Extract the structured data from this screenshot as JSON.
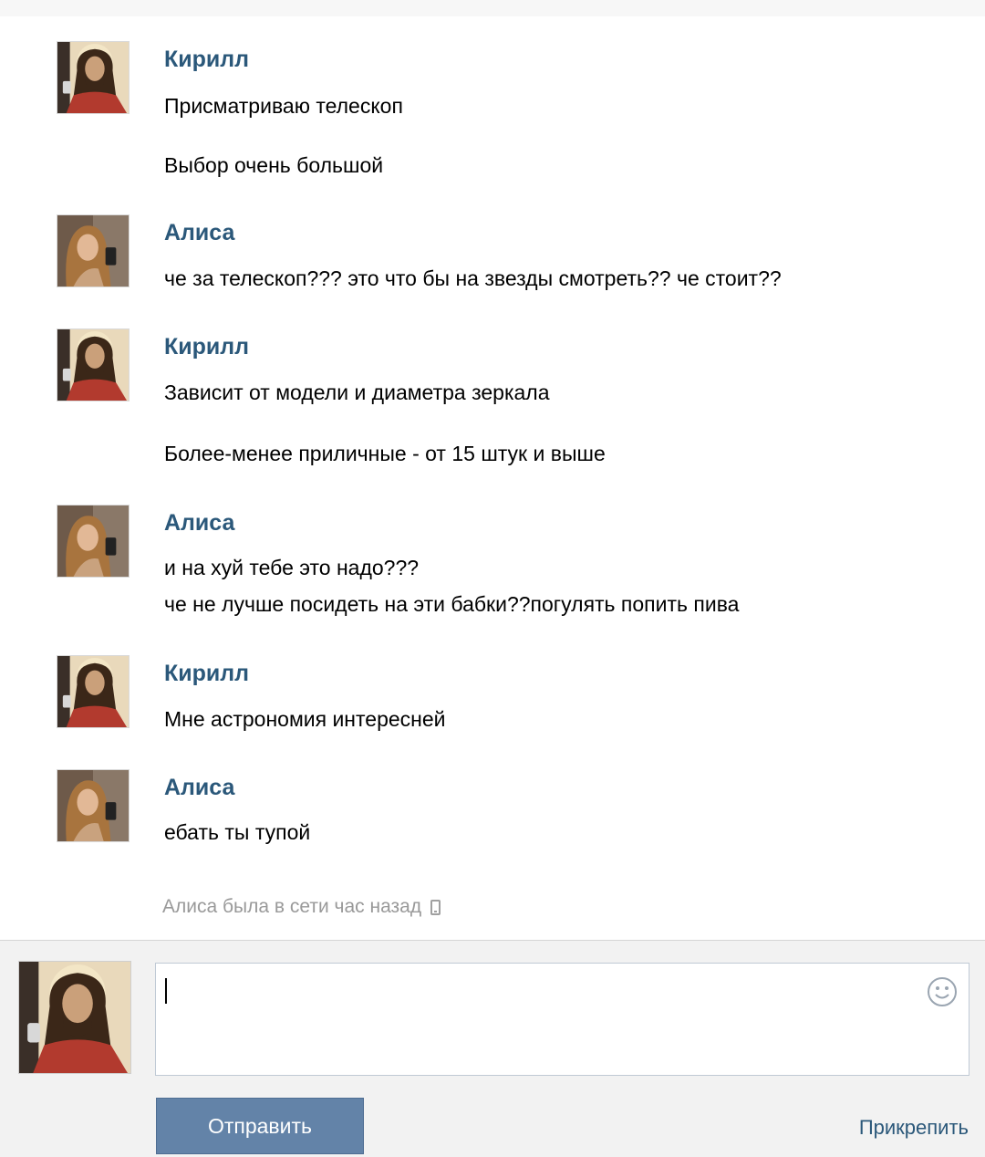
{
  "messages": [
    {
      "sender": "Кирилл",
      "avatar": "jesus-avatar",
      "lines": [
        "Присматриваю телескоп",
        "Выбор очень большой"
      ]
    },
    {
      "sender": "Алиса",
      "avatar": "girl-avatar",
      "lines": [
        "че за телескоп??? это что бы на звезды смотреть?? че стоит??"
      ]
    },
    {
      "sender": "Кирилл",
      "avatar": "jesus-avatar",
      "lines": [
        "Зависит от модели и диаметра зеркала",
        "Более-менее приличные - от 15 штук и выше"
      ]
    },
    {
      "sender": "Алиса",
      "avatar": "girl-avatar",
      "lines": [
        "и на хуй тебе это надо???",
        "че не лучше посидеть на эти бабки??погулять попить пива"
      ]
    },
    {
      "sender": "Кирилл",
      "avatar": "jesus-avatar",
      "lines": [
        "Мне астрономия интересней"
      ]
    },
    {
      "sender": "Алиса",
      "avatar": "girl-avatar",
      "lines": [
        "ебать ты тупой"
      ]
    }
  ],
  "status": {
    "text": "Алиса была в сети час назад",
    "icon": "mobile-phone-icon"
  },
  "composer": {
    "input_value": "",
    "smile_icon": "smile-icon",
    "send_label": "Отправить",
    "attach_label": "Прикрепить"
  },
  "colors": {
    "link": "#2b587a",
    "button": "#6383a8",
    "status": "#999999"
  }
}
